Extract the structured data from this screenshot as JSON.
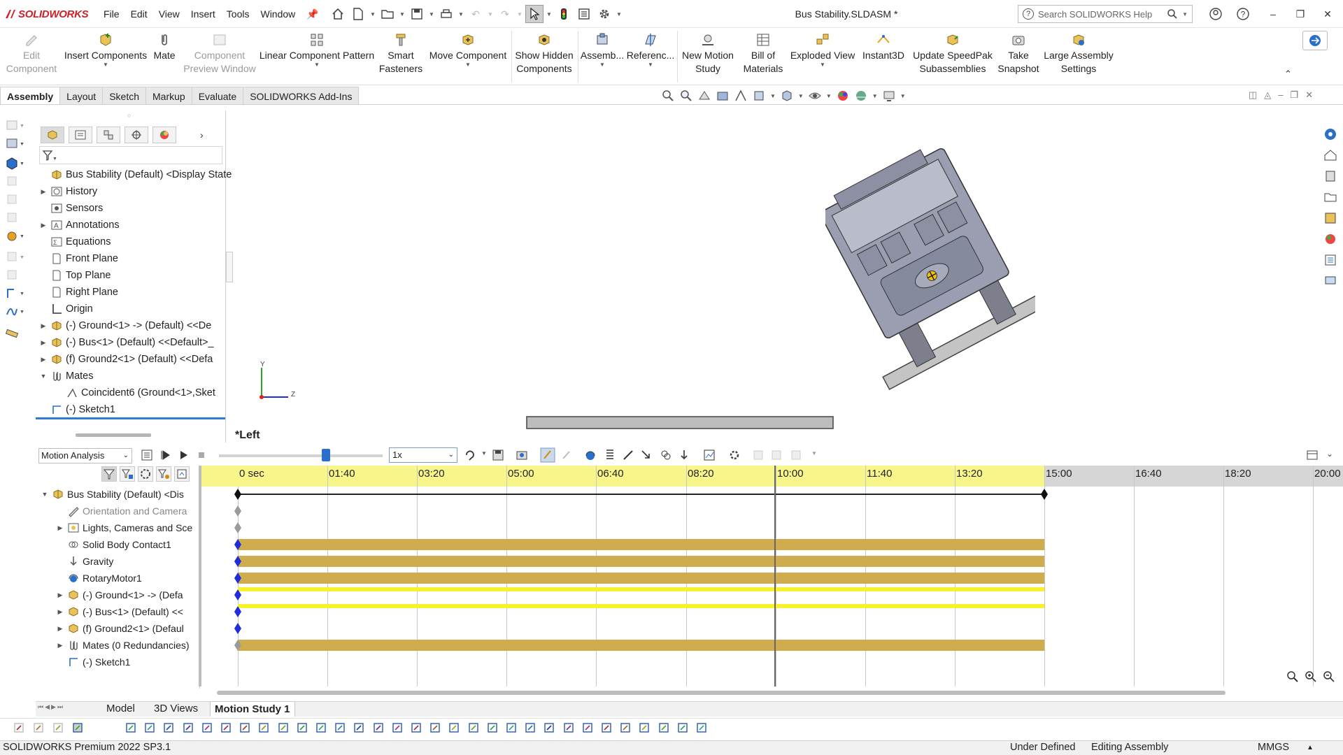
{
  "app": {
    "brand": "SOLIDWORKS",
    "document_title": "Bus Stability.SLDASM *",
    "menus": [
      "File",
      "Edit",
      "View",
      "Insert",
      "Tools",
      "Window"
    ],
    "search_placeholder": "Search SOLIDWORKS Help"
  },
  "ribbon": {
    "edit_component": {
      "line1": "Edit",
      "line2": "Component"
    },
    "insert_components": "Insert Components",
    "mate": "Mate",
    "component_preview": {
      "line1": "Component",
      "line2": "Preview Window"
    },
    "linear_pattern": "Linear Component Pattern",
    "smart_fasteners": {
      "line1": "Smart",
      "line2": "Fasteners"
    },
    "move_component": "Move Component",
    "show_hidden": {
      "line1": "Show Hidden",
      "line2": "Components"
    },
    "assembly": "Assemb...",
    "reference": "Referenc...",
    "new_motion_study": {
      "line1": "New Motion",
      "line2": "Study"
    },
    "bill_of_materials": {
      "line1": "Bill of",
      "line2": "Materials"
    },
    "exploded_view": "Exploded View",
    "instant3d": "Instant3D",
    "update_speedpak": {
      "line1": "Update SpeedPak",
      "line2": "Subassemblies"
    },
    "take_snapshot": {
      "line1": "Take",
      "line2": "Snapshot"
    },
    "large_assembly": {
      "line1": "Large Assembly",
      "line2": "Settings"
    }
  },
  "command_tabs": [
    "Assembly",
    "Layout",
    "Sketch",
    "Markup",
    "Evaluate",
    "SOLIDWORKS Add-Ins"
  ],
  "feature_tree": {
    "root": "Bus Stability (Default) <Display State",
    "items": [
      "History",
      "Sensors",
      "Annotations",
      "Equations",
      "Front Plane",
      "Top Plane",
      "Right Plane",
      "Origin",
      "(-) Ground<1> -> (Default) <<De",
      "(-) Bus<1> (Default) <<Default>_",
      "(f) Ground2<1> (Default) <<Defa",
      "Mates",
      "Coincident6 (Ground<1>,Sket",
      "(-) Sketch1"
    ]
  },
  "viewport": {
    "view_label": "*Left",
    "triad_y": "Y",
    "triad_z": "Z"
  },
  "motion": {
    "study_type": "Motion Analysis",
    "playback_speed": "1x",
    "ruler_ticks": [
      "0 sec",
      "01:40",
      "03:20",
      "05:00",
      "06:40",
      "08:20",
      "10:00",
      "11:40",
      "13:20",
      "15:00",
      "16:40",
      "18:20",
      "20:00"
    ],
    "tree": {
      "root": "Bus Stability (Default) <Dis",
      "items": [
        "Orientation and Camera",
        "Lights, Cameras and Sce",
        "Solid Body Contact1",
        "Gravity",
        "RotaryMotor1",
        "(-) Ground<1> -> (Defa",
        "(-) Bus<1> (Default) <<",
        "(f) Ground2<1> (Defaul",
        "Mates (0 Redundancies)",
        "(-) Sketch1"
      ]
    }
  },
  "bottom_tabs": [
    "Model",
    "3D Views",
    "Motion Study 1"
  ],
  "status": {
    "product": "SOLIDWORKS Premium 2022 SP3.1",
    "definition": "Under Defined",
    "mode": "Editing Assembly",
    "units": "MMGS"
  },
  "colors": {
    "brand_red": "#d11f26",
    "timeline_header": "#f8f58a",
    "key_bar": "#cfad4e",
    "highlight_bar": "#f7f22c",
    "keypoint": "#1f2ed8"
  }
}
